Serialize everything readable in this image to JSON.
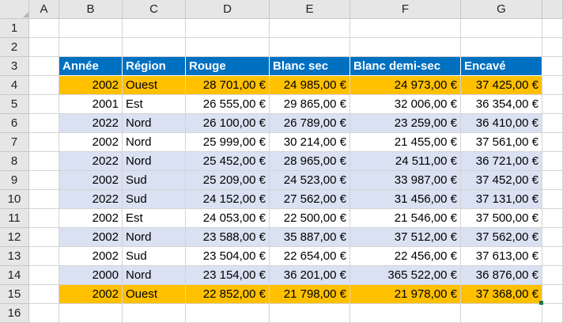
{
  "columns": [
    "A",
    "B",
    "C",
    "D",
    "E",
    "F",
    "G"
  ],
  "row_numbers": [
    "1",
    "2",
    "3",
    "4",
    "5",
    "6",
    "7",
    "8",
    "9",
    "10",
    "11",
    "12",
    "13",
    "14",
    "15",
    "16"
  ],
  "table": {
    "headers": [
      "Année",
      "Région",
      "Rouge",
      "Blanc sec",
      "Blanc demi-sec",
      "Encavé"
    ],
    "rows": [
      [
        "2002",
        "Ouest",
        "28 701,00 €",
        "24 985,00 €",
        "24 973,00 €",
        "37 425,00 €"
      ],
      [
        "2001",
        "Est",
        "26 555,00 €",
        "29 865,00 €",
        "32 006,00 €",
        "36 354,00 €"
      ],
      [
        "2022",
        "Nord",
        "26 100,00 €",
        "26 789,00 €",
        "23 259,00 €",
        "36 410,00 €"
      ],
      [
        "2002",
        "Nord",
        "25 999,00 €",
        "30 214,00 €",
        "21 455,00 €",
        "37 561,00 €"
      ],
      [
        "2022",
        "Nord",
        "25 452,00 €",
        "28 965,00 €",
        "24 511,00 €",
        "36 721,00 €"
      ],
      [
        "2002",
        "Sud",
        "25 209,00 €",
        "24 523,00 €",
        "33 987,00 €",
        "37 452,00 €"
      ],
      [
        "2022",
        "Sud",
        "24 152,00 €",
        "27 562,00 €",
        "31 456,00 €",
        "37 131,00 €"
      ],
      [
        "2002",
        "Est",
        "24 053,00 €",
        "22 500,00 €",
        "21 546,00 €",
        "37 500,00 €"
      ],
      [
        "2002",
        "Nord",
        "23 588,00 €",
        "35 887,00 €",
        "37 512,00 €",
        "37 562,00 €"
      ],
      [
        "2002",
        "Sud",
        "23 504,00 €",
        "22 654,00 €",
        "22 456,00 €",
        "37 613,00 €"
      ],
      [
        "2000",
        "Nord",
        "23 154,00 €",
        "36 201,00 €",
        "365 522,00 €",
        "36 876,00 €"
      ],
      [
        "2002",
        "Ouest",
        "22 852,00 €",
        "21 798,00 €",
        "21 978,00 €",
        "37 368,00 €"
      ]
    ]
  },
  "colors": {
    "header_bg": "#0070c0",
    "highlight": "#ffc000",
    "band": "#d9e1f2",
    "sheet_header": "#e6e6e6"
  },
  "row_styles": [
    "highlight",
    "plain",
    "band",
    "plain",
    "band",
    "band",
    "band",
    "plain",
    "band",
    "plain",
    "band",
    "highlight"
  ]
}
